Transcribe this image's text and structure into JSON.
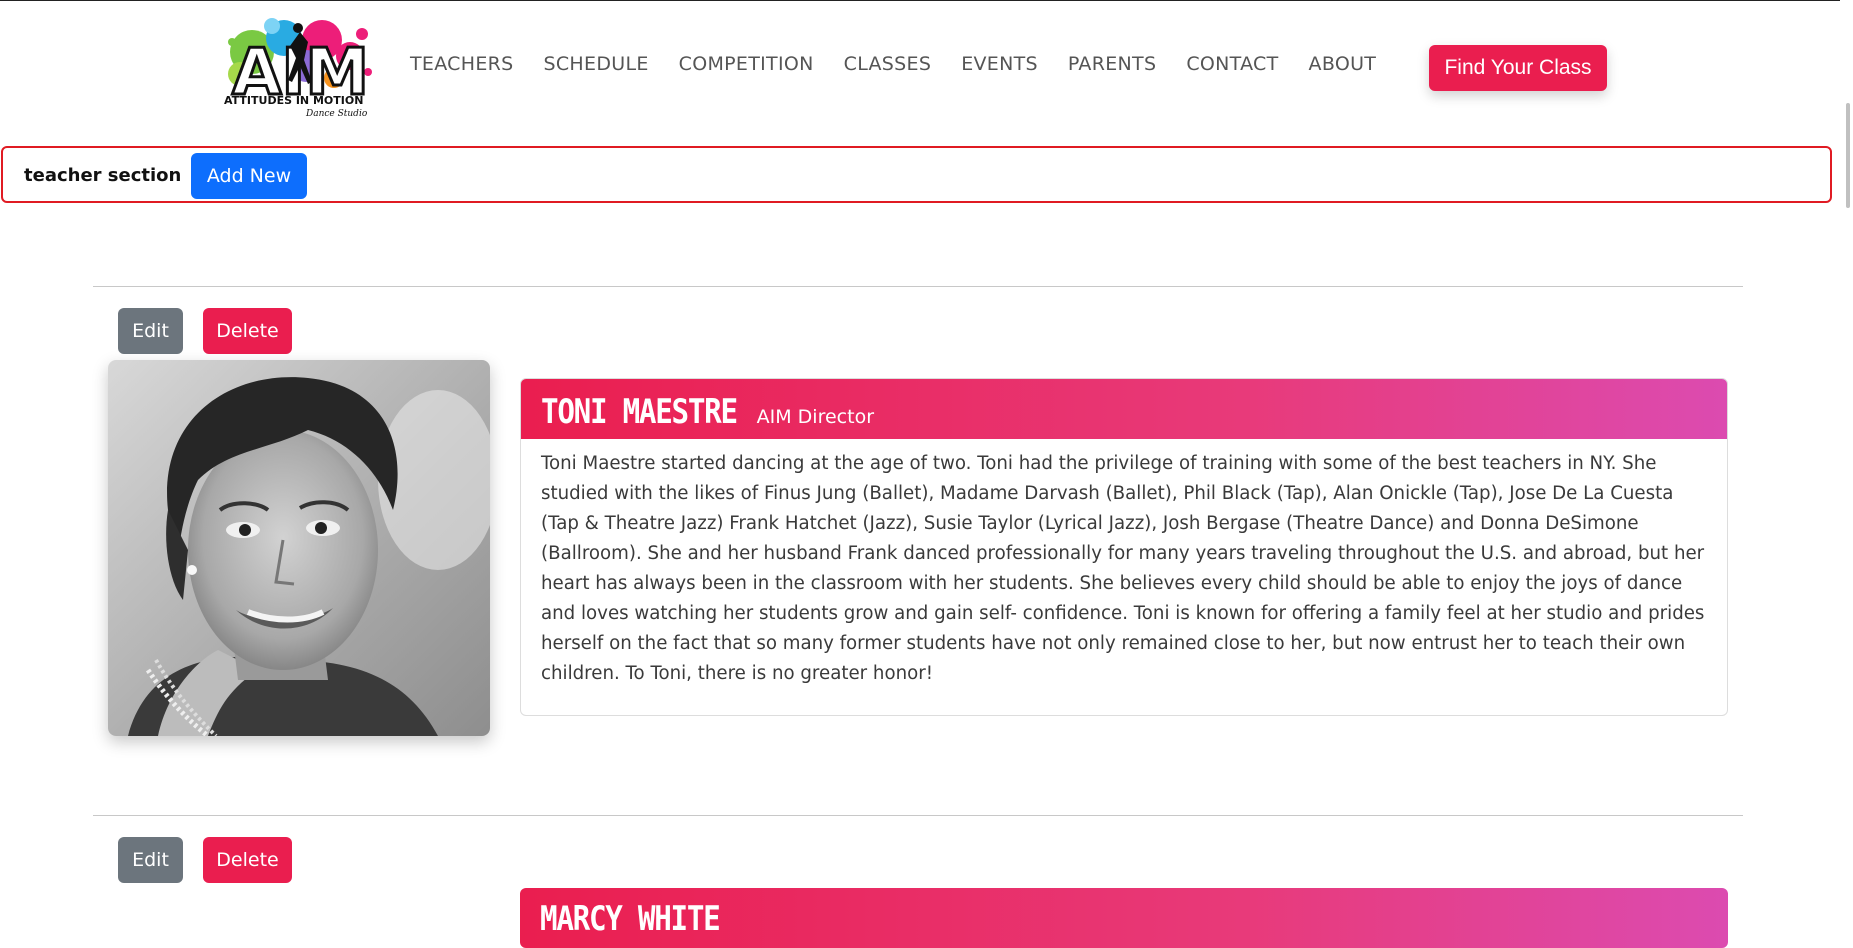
{
  "brand": {
    "logo_text": "AIM",
    "logo_subtitle": "ATTITUDES IN MOTION",
    "logo_tagline": "Dance Studio"
  },
  "nav": {
    "items": [
      "TEACHERS",
      "SCHEDULE",
      "COMPETITION",
      "CLASSES",
      "EVENTS",
      "PARENTS",
      "CONTACT",
      "ABOUT"
    ],
    "cta_label": "Find Your Class"
  },
  "admin": {
    "section_label": "teacher section",
    "add_label": "Add New"
  },
  "teachers": [
    {
      "edit_label": "Edit",
      "delete_label": "Delete",
      "name": "TONI MAESTRE",
      "role": "AIM Director",
      "bio": "Toni Maestre started dancing at the age of two. Toni had the privilege of training with some of the best teachers in NY. She studied with the likes of Finus Jung (Ballet), Madame Darvash (Ballet), Phil Black (Tap), Alan Onickle (Tap), Jose De La Cuesta (Tap & Theatre Jazz) Frank Hatchet (Jazz), Susie Taylor (Lyrical Jazz), Josh Bergase (Theatre Dance) and Donna DeSimone (Ballroom). She and her husband Frank danced professionally for many years traveling throughout the U.S. and abroad, but her heart has always been in the classroom with her students. She believes every child should be able to enjoy the joys of dance and loves watching her students grow and gain self- confidence. Toni is known for offering a family feel at her studio and prides herself on the fact that so many former students have not only remained close to her, but now entrust her to teach their own children. To Toni, there is no greater honor!"
    },
    {
      "edit_label": "Edit",
      "delete_label": "Delete",
      "name": "MARCY WHITE",
      "role": "",
      "bio": ""
    }
  ],
  "colors": {
    "accent": "#ea1e4f",
    "primary": "#0d6efd",
    "secondary": "#6c757d",
    "admin_border": "#e01b23"
  }
}
